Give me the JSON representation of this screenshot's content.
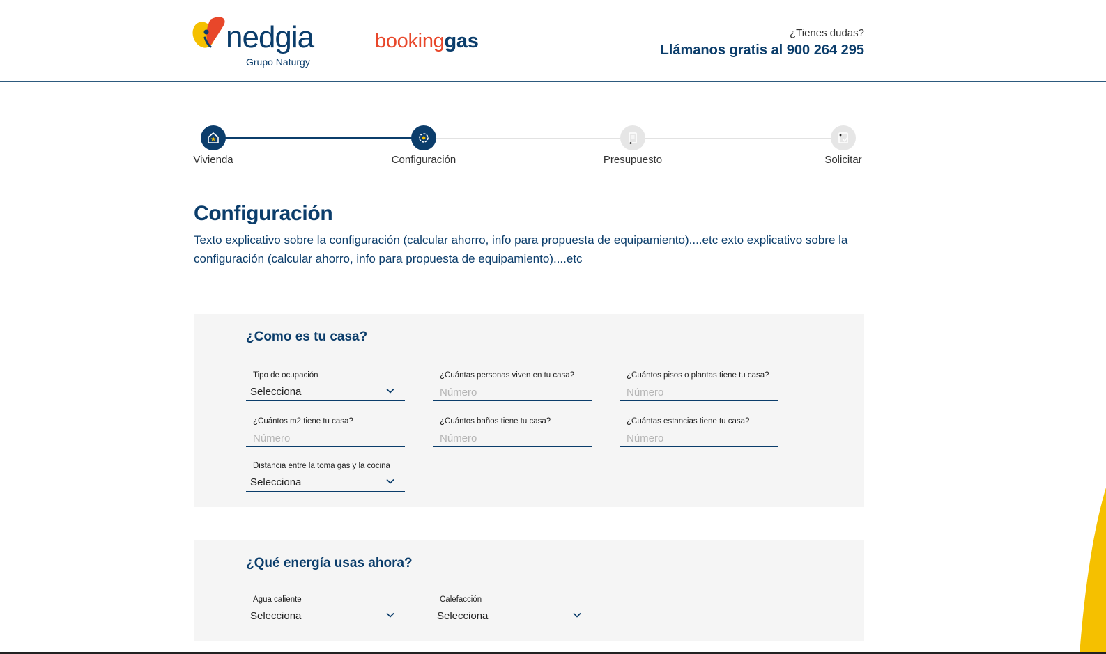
{
  "header": {
    "logo_text": "nedgia",
    "logo_subtitle": "Grupo Naturgy",
    "brand_part1": "booking",
    "brand_part2": "gas",
    "help_question": "¿Tienes dudas?",
    "help_phone": "Llámanos gratis al 900 264 295"
  },
  "stepper": {
    "steps": [
      {
        "label": "Vivienda",
        "state": "completed",
        "icon": "house-icon"
      },
      {
        "label": "Configuración",
        "state": "current",
        "icon": "gear-icon"
      },
      {
        "label": "Presupuesto",
        "state": "pending",
        "icon": "document-icon"
      },
      {
        "label": "Solicitar",
        "state": "pending",
        "icon": "signature-icon"
      }
    ]
  },
  "main": {
    "title": "Configuración",
    "description": "Texto explicativo sobre la configuración (calcular ahorro, info para propuesta de equipamiento)....etc exto explicativo sobre la configuración (calcular ahorro, info para propuesta de equipamiento)....etc"
  },
  "section_house": {
    "title": "¿Como es tu casa?",
    "fields": {
      "occupancy": {
        "label": "Tipo de ocupación",
        "value": "Selecciona"
      },
      "people": {
        "label": "¿Cuántas personas viven en tu casa?",
        "placeholder": "Número"
      },
      "floors": {
        "label": "¿Cuántos pisos o plantas tiene tu casa?",
        "placeholder": "Número"
      },
      "area": {
        "label": "¿Cuántos m2 tiene tu casa?",
        "placeholder": "Número"
      },
      "bathrooms": {
        "label": "¿Cuántos baños tiene tu casa?",
        "placeholder": "Número"
      },
      "rooms": {
        "label": "¿Cuántas estancias tiene tu casa?",
        "placeholder": "Número"
      },
      "distance": {
        "label": "Distancia entre la toma gas y la cocina",
        "value": "Selecciona"
      }
    }
  },
  "section_energy": {
    "title": "¿Qué energía usas ahora?",
    "fields": {
      "hot_water": {
        "label": "Agua caliente",
        "value": "Selecciona"
      },
      "heating": {
        "label": "Calefacción",
        "value": "Selecciona"
      }
    }
  },
  "colors": {
    "primary": "#0b3d6b",
    "accent_orange": "#e8472a",
    "accent_yellow": "#f5c000",
    "panel_bg": "#f5f5f5"
  }
}
